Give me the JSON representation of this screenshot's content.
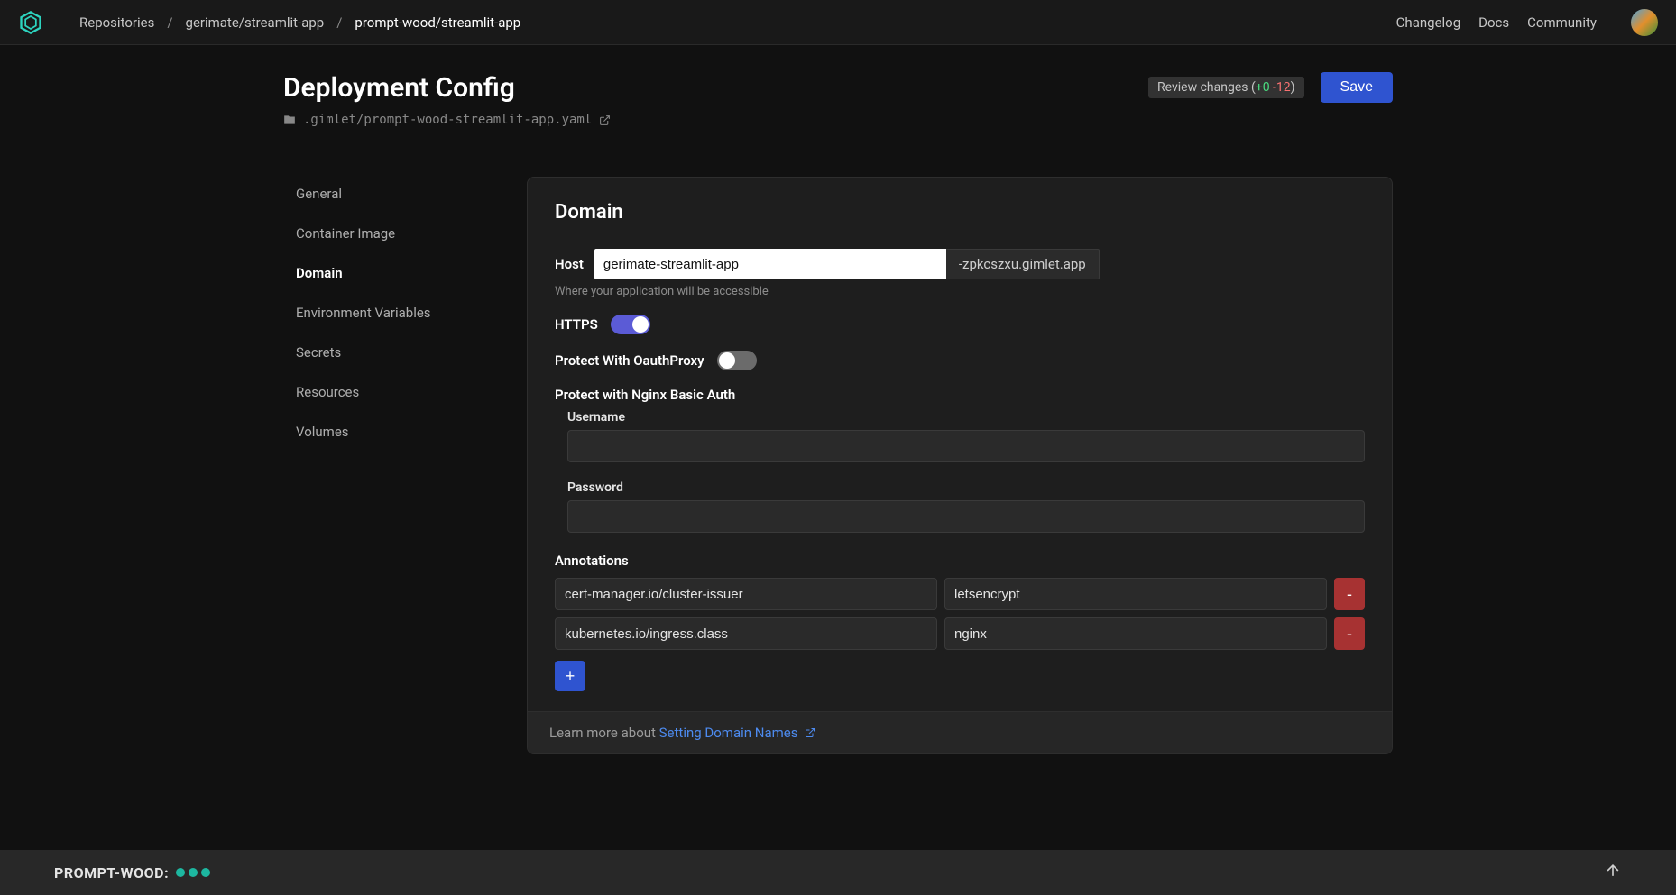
{
  "topbar": {
    "breadcrumb": {
      "root": "Repositories",
      "sep": "/",
      "mid": "gerimate/streamlit-app",
      "current": "prompt-wood/streamlit-app"
    },
    "nav": {
      "changelog": "Changelog",
      "docs": "Docs",
      "community": "Community"
    }
  },
  "header": {
    "title": "Deployment Config",
    "file_path": ".gimlet/prompt-wood-streamlit-app.yaml",
    "review_prefix": "Review changes (",
    "review_add": "+0",
    "review_del": "-12",
    "review_suffix": ")",
    "save": "Save"
  },
  "sidebar": {
    "items": [
      {
        "label": "General"
      },
      {
        "label": "Container Image"
      },
      {
        "label": "Domain"
      },
      {
        "label": "Environment Variables"
      },
      {
        "label": "Secrets"
      },
      {
        "label": "Resources"
      },
      {
        "label": "Volumes"
      }
    ]
  },
  "panel": {
    "title": "Domain",
    "host_label": "Host",
    "host_value": "gerimate-streamlit-app",
    "host_suffix": "-zpkcszxu.gimlet.app",
    "host_hint": "Where your application will be accessible",
    "https_label": "HTTPS",
    "oauth_label": "Protect With OauthProxy",
    "basic_auth_head": "Protect with Nginx Basic Auth",
    "username_label": "Username",
    "password_label": "Password",
    "annotations_label": "Annotations",
    "annotations": [
      {
        "key": "cert-manager.io/cluster-issuer",
        "value": "letsencrypt"
      },
      {
        "key": "kubernetes.io/ingress.class",
        "value": "nginx"
      }
    ],
    "add_label": "+",
    "del_label": "-",
    "footer_prefix": "Learn more about ",
    "footer_link": "Setting Domain Names"
  },
  "bottom": {
    "env": "PROMPT-WOOD:"
  }
}
